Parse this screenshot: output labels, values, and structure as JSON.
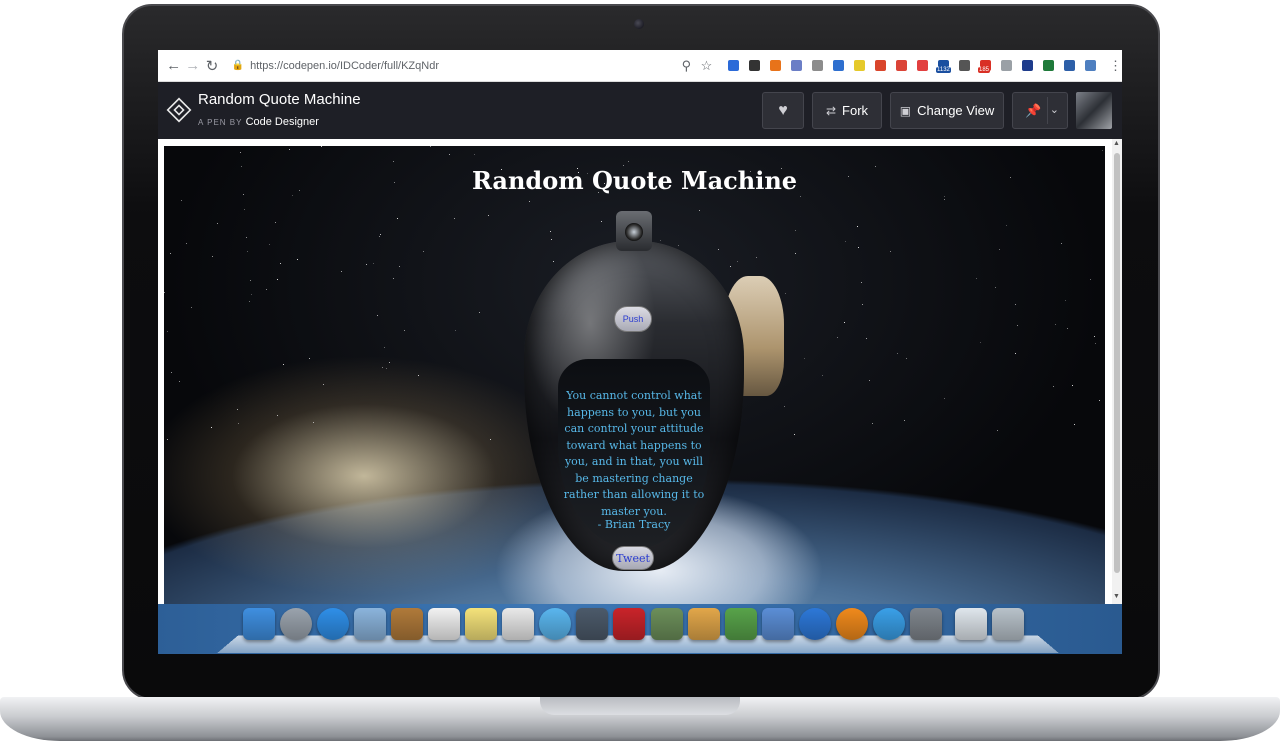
{
  "browser": {
    "url": "https://codepen.io/IDCoder/full/KZqNdr",
    "extension_badges": [
      "1132",
      "185"
    ]
  },
  "codepen": {
    "pen_title": "Random Quote Machine",
    "byline_prefix": "A PEN BY",
    "author": "Code Designer",
    "fork_label": "Fork",
    "change_view_label": "Change View"
  },
  "app": {
    "title": "Random Quote Machine",
    "push_label": "Push",
    "quote": "You cannot control what happens to you, but you can control your attitude toward what happens to you, and in that, you will be mastering change rather than allowing it to master you.",
    "author": "- Brian Tracy",
    "tweet_label": "Tweet"
  },
  "dock": {
    "icons": [
      {
        "name": "finder-icon",
        "color": "#3f8fe0"
      },
      {
        "name": "launchpad-icon",
        "color": "#9aa3ad"
      },
      {
        "name": "safari-icon",
        "color": "#2f8fe8"
      },
      {
        "name": "mail-icon",
        "color": "#8bb4dc"
      },
      {
        "name": "contacts-icon",
        "color": "#b07a3a"
      },
      {
        "name": "calendar-icon",
        "color": "#f2f2f2"
      },
      {
        "name": "notes-icon",
        "color": "#f4e27a"
      },
      {
        "name": "reminders-icon",
        "color": "#e9e9e9"
      },
      {
        "name": "messages-icon",
        "color": "#5ab6ee"
      },
      {
        "name": "facetime-icon",
        "color": "#4c5a6a"
      },
      {
        "name": "photo-booth-icon",
        "color": "#c9242a"
      },
      {
        "name": "iphoto-icon",
        "color": "#6c8f5a"
      },
      {
        "name": "pages-icon",
        "color": "#e2a74a"
      },
      {
        "name": "numbers-icon",
        "color": "#58a34a"
      },
      {
        "name": "keynote-icon",
        "color": "#5b8ed6"
      },
      {
        "name": "itunes-icon",
        "color": "#2d78d8"
      },
      {
        "name": "ibooks-icon",
        "color": "#f08a1c"
      },
      {
        "name": "app-store-icon",
        "color": "#3aa0e8"
      },
      {
        "name": "system-preferences-icon",
        "color": "#7f858c"
      },
      {
        "name": "preview-icon",
        "color": "#dfe6ec"
      },
      {
        "name": "trash-icon",
        "color": "#b8c2ca"
      }
    ]
  },
  "extensions": [
    {
      "name": "zoom-icon",
      "color": "#5f6368"
    },
    {
      "name": "bookmark-star-icon",
      "color": "#5f6368"
    },
    {
      "name": "vue-devtools-icon",
      "color": "#2b6ad8"
    },
    {
      "name": "extension-i-icon",
      "color": "#333333"
    },
    {
      "name": "extension-x-icon",
      "color": "#e8731a"
    },
    {
      "name": "eyedropper-icon",
      "color": "#6b7ec6"
    },
    {
      "name": "shield-icon",
      "color": "#8c8c8c"
    },
    {
      "name": "screenshot-icon",
      "color": "#2e6fcf"
    },
    {
      "name": "json-icon",
      "color": "#e5c92a"
    },
    {
      "name": "extension-arrow-icon",
      "color": "#d9452b"
    },
    {
      "name": "extension-g-icon",
      "color": "#db4437"
    },
    {
      "name": "extension-square-icon",
      "color": "#e23f3f"
    },
    {
      "name": "extension-1132-icon",
      "color": "#1a4fa0"
    },
    {
      "name": "check-icon",
      "color": "#555555"
    },
    {
      "name": "gmail-icon",
      "color": "#d93025"
    },
    {
      "name": "extension-circle-icon",
      "color": "#9aa0a6"
    },
    {
      "name": "extension-flag-icon",
      "color": "#1e3c8c"
    },
    {
      "name": "extension-bw-icon",
      "color": "#1f7a3a"
    },
    {
      "name": "extension-grid-icon",
      "color": "#2d5fa8"
    },
    {
      "name": "extension-audio-icon",
      "color": "#4e7fc0"
    }
  ]
}
